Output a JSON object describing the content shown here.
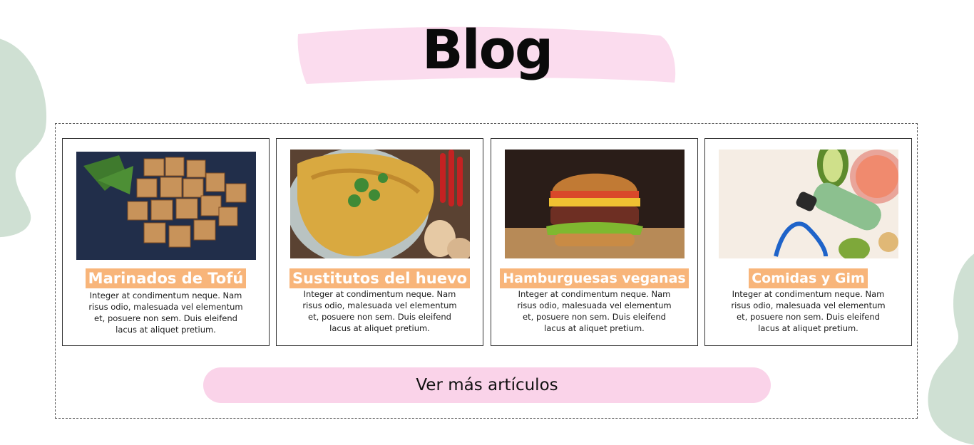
{
  "header": {
    "title": "Blog"
  },
  "posts": [
    {
      "title": "Marinados de Tofú",
      "description": "Integer at condimentum neque. Nam risus odio, malesuada vel elementum et, posuere non sem. Duis eleifend lacus at aliquet pretium."
    },
    {
      "title": "Sustitutos del huevo",
      "description": "Integer at condimentum neque. Nam risus odio, malesuada vel elementum et, posuere non sem. Duis eleifend lacus at aliquet pretium."
    },
    {
      "title": "Hamburguesas veganas",
      "description": "Integer at condimentum neque. Nam risus odio, malesuada vel elementum et, posuere non sem. Duis eleifend lacus at aliquet pretium."
    },
    {
      "title": "Comidas y Gim",
      "description": "Integer at condimentum neque. Nam risus odio, malesuada vel elementum et, posuere non sem. Duis eleifend lacus at aliquet pretium."
    }
  ],
  "cta": {
    "label": "Ver más artículos"
  },
  "colors": {
    "accent_pink": "#fad3e9",
    "title_tag": "#f8b57a",
    "blob_green": "#cfe0d3"
  }
}
